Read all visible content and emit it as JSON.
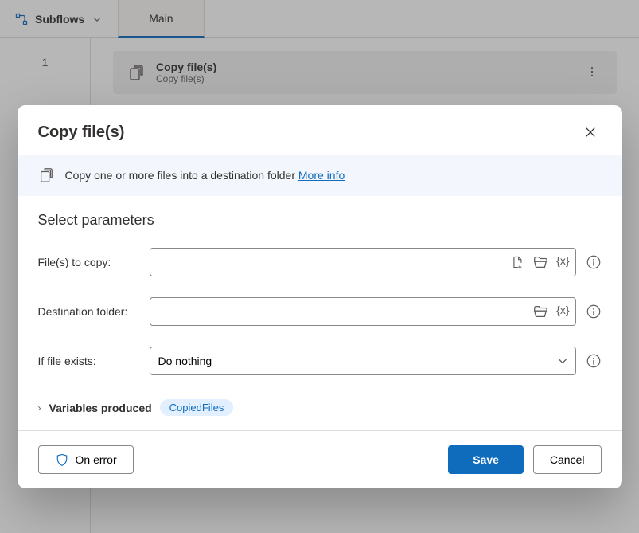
{
  "top": {
    "subflows_label": "Subflows",
    "tab_main": "Main"
  },
  "editor": {
    "line1": "1",
    "action_title": "Copy file(s)",
    "action_sub": "Copy file(s)"
  },
  "modal": {
    "title": "Copy file(s)",
    "info_text": "Copy one or more files into a destination folder ",
    "info_link": "More info",
    "section": "Select parameters",
    "fields": {
      "files_label": "File(s) to copy:",
      "files_value": "",
      "dest_label": "Destination folder:",
      "dest_value": "",
      "exists_label": "If file exists:",
      "exists_value": "Do nothing"
    },
    "vars": {
      "caret": "›",
      "label": "Variables produced",
      "chip": "CopiedFiles"
    },
    "footer": {
      "on_error": "On error",
      "save": "Save",
      "cancel": "Cancel"
    }
  }
}
